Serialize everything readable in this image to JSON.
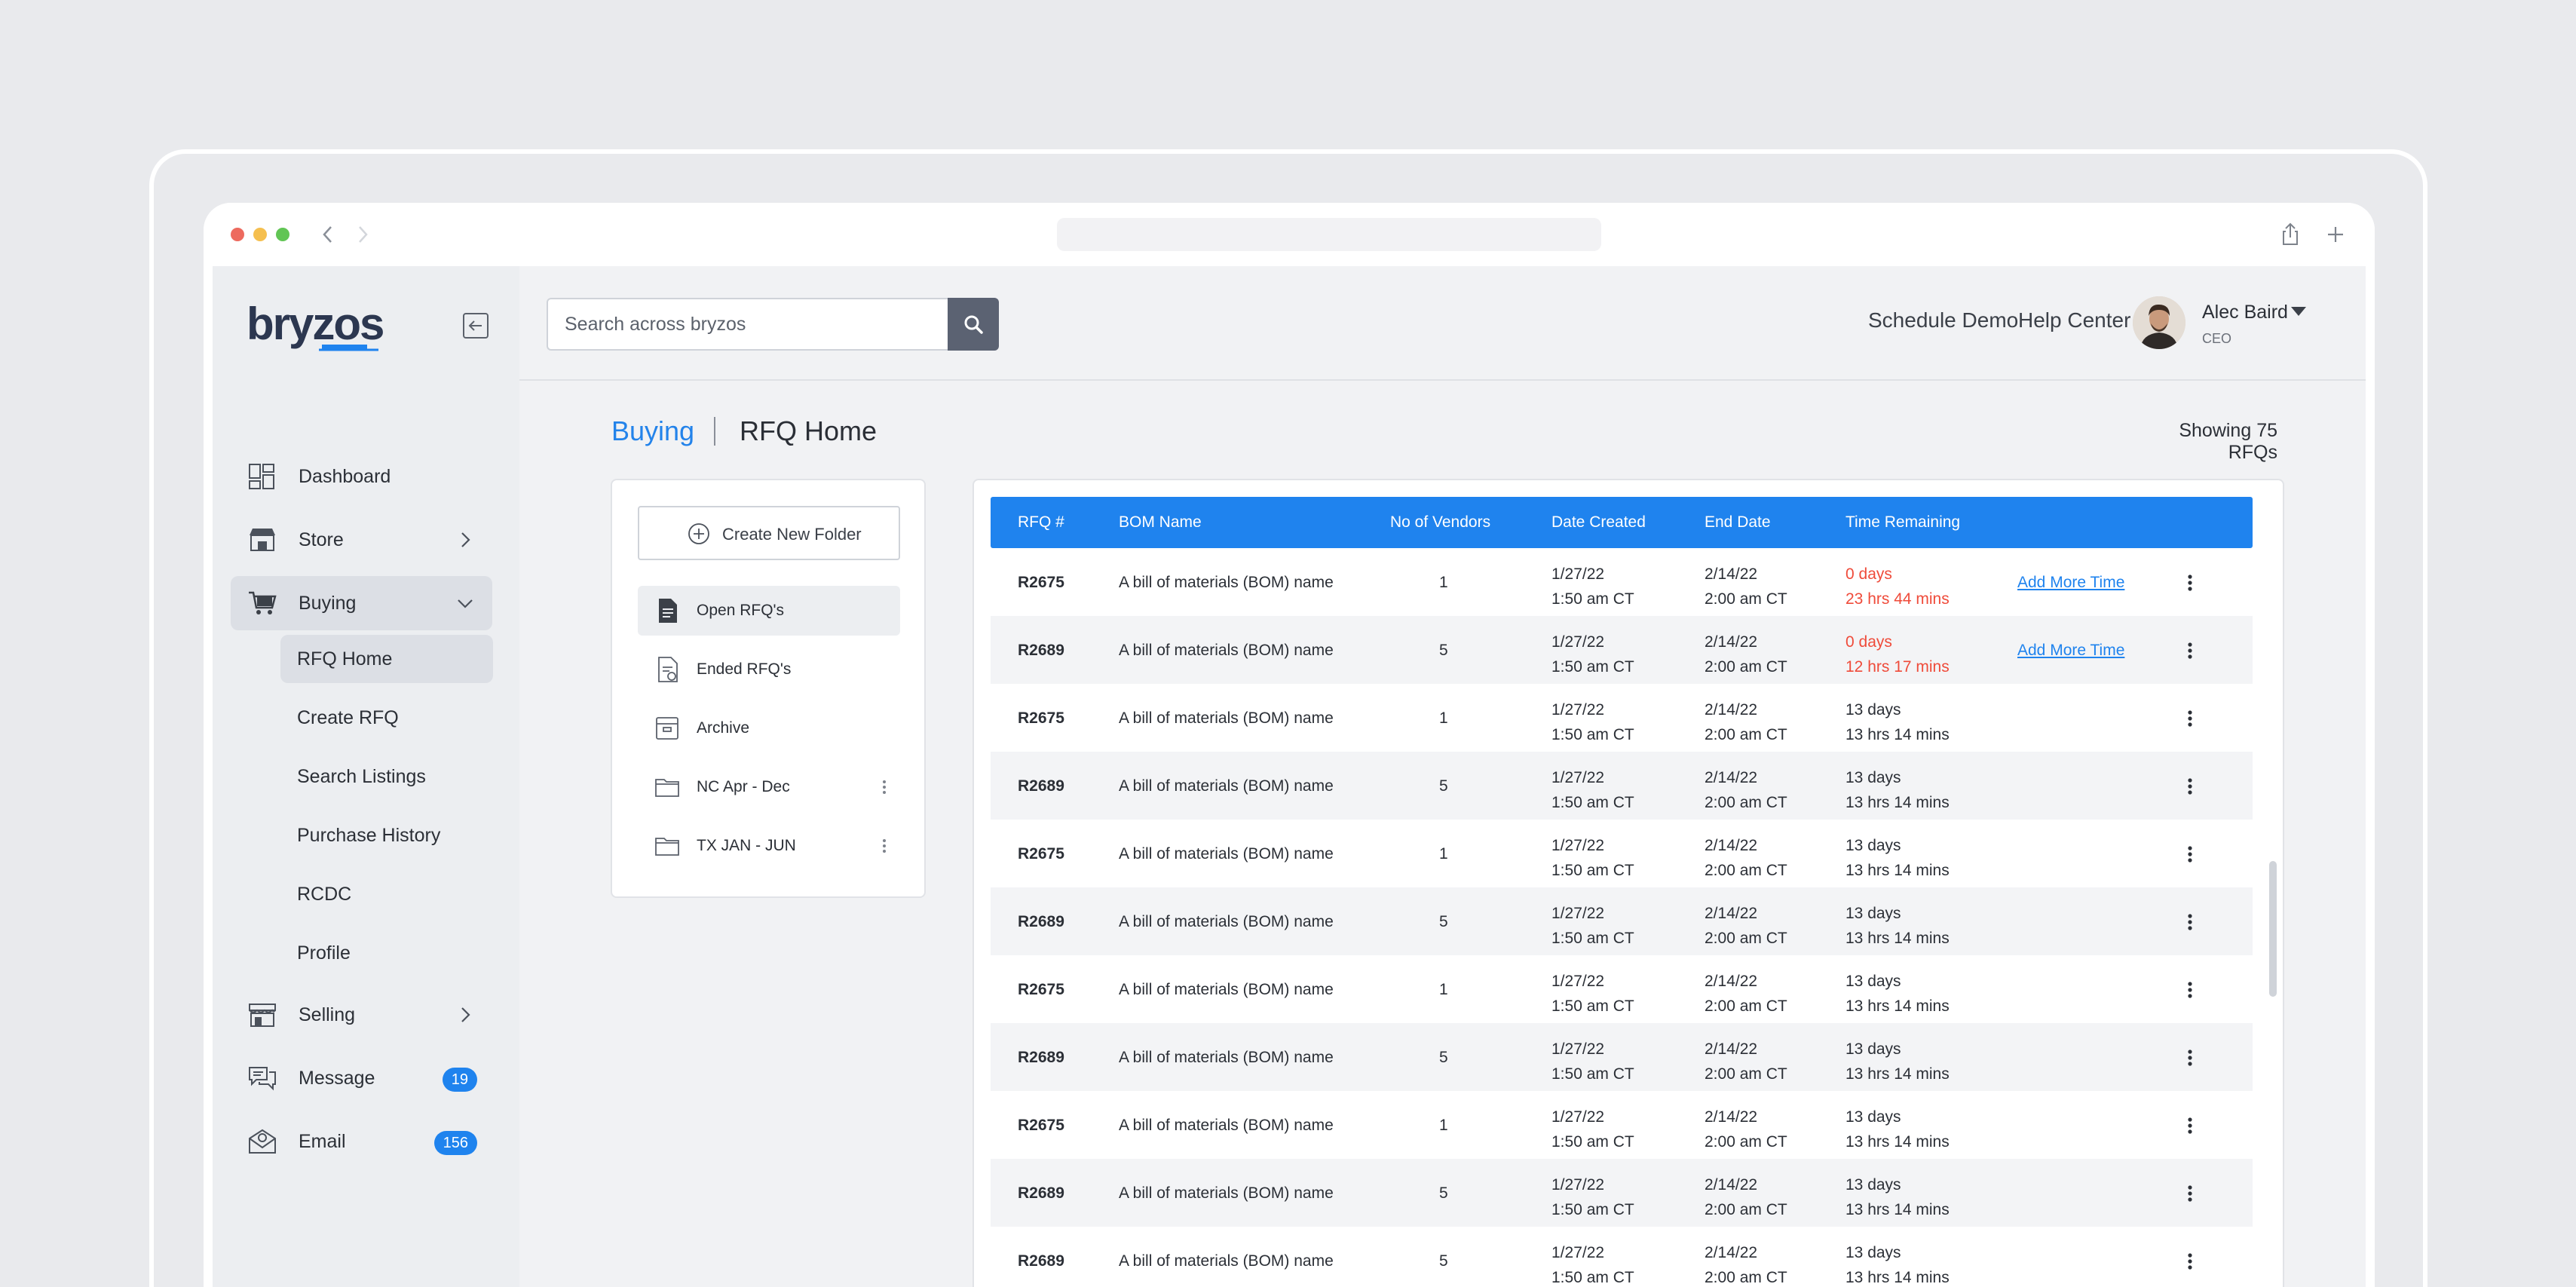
{
  "app": {
    "brand": "bryzos",
    "colors": {
      "accent": "#1f83ee",
      "danger": "#ef4b3a",
      "sidebar": "#eceef1"
    }
  },
  "topbar": {
    "search_placeholder": "Search across bryzos",
    "links": [
      "Schedule Demo",
      "Help Center"
    ],
    "user": {
      "name": "Alec Baird",
      "role": "CEO"
    }
  },
  "sidebar": {
    "items": [
      {
        "label": "Dashboard",
        "icon": "dashboard-icon"
      },
      {
        "label": "Store",
        "icon": "store-icon"
      },
      {
        "label": "Buying",
        "icon": "cart-icon"
      },
      {
        "label": "Selling",
        "icon": "shop-icon"
      },
      {
        "label": "Message",
        "icon": "chat-icon",
        "badge": "19"
      },
      {
        "label": "Email",
        "icon": "mail-icon",
        "badge": "156"
      }
    ],
    "buying_sub": [
      "RFQ Home",
      "Create RFQ",
      "Search Listings",
      "Purchase History",
      "RCDC",
      "Profile"
    ]
  },
  "page": {
    "breadcrumb_section": "Buying",
    "breadcrumb_title": "RFQ Home",
    "showing": "Showing 75 RFQs"
  },
  "folders": {
    "create_label": "Create New Folder",
    "items": [
      "Open RFQ's",
      "Ended RFQ's",
      "Archive",
      "NC Apr - Dec",
      "TX JAN - JUN"
    ]
  },
  "table": {
    "headers": [
      "RFQ #",
      "BOM Name",
      "No of Vendors",
      "Date Created",
      "End Date",
      "Time Remaining"
    ],
    "action_label": "Add More Time",
    "rows": [
      {
        "id": "R2675",
        "bom": "A bill of materials (BOM) name",
        "vendors": "1",
        "created_date": "1/27/22",
        "created_time": "1:50 am CT",
        "end_date": "2/14/22",
        "end_time": "2:00 am CT",
        "remaining_days": "0 days",
        "remaining_time": "23 hrs 44 mins",
        "urgent": true
      },
      {
        "id": "R2689",
        "bom": "A bill of materials (BOM) name",
        "vendors": "5",
        "created_date": "1/27/22",
        "created_time": "1:50 am CT",
        "end_date": "2/14/22",
        "end_time": "2:00 am CT",
        "remaining_days": "0 days",
        "remaining_time": "12 hrs 17 mins",
        "urgent": true
      },
      {
        "id": "R2675",
        "bom": "A bill of materials (BOM) name",
        "vendors": "1",
        "created_date": "1/27/22",
        "created_time": "1:50 am CT",
        "end_date": "2/14/22",
        "end_time": "2:00 am CT",
        "remaining_days": "13 days",
        "remaining_time": "13 hrs 14 mins",
        "urgent": false
      },
      {
        "id": "R2689",
        "bom": "A bill of materials (BOM) name",
        "vendors": "5",
        "created_date": "1/27/22",
        "created_time": "1:50 am CT",
        "end_date": "2/14/22",
        "end_time": "2:00 am CT",
        "remaining_days": "13 days",
        "remaining_time": "13 hrs 14 mins",
        "urgent": false
      },
      {
        "id": "R2675",
        "bom": "A bill of materials (BOM) name",
        "vendors": "1",
        "created_date": "1/27/22",
        "created_time": "1:50 am CT",
        "end_date": "2/14/22",
        "end_time": "2:00 am CT",
        "remaining_days": "13 days",
        "remaining_time": "13 hrs 14 mins",
        "urgent": false
      },
      {
        "id": "R2689",
        "bom": "A bill of materials (BOM) name",
        "vendors": "5",
        "created_date": "1/27/22",
        "created_time": "1:50 am CT",
        "end_date": "2/14/22",
        "end_time": "2:00 am CT",
        "remaining_days": "13 days",
        "remaining_time": "13 hrs 14 mins",
        "urgent": false
      },
      {
        "id": "R2675",
        "bom": "A bill of materials (BOM) name",
        "vendors": "1",
        "created_date": "1/27/22",
        "created_time": "1:50 am CT",
        "end_date": "2/14/22",
        "end_time": "2:00 am CT",
        "remaining_days": "13 days",
        "remaining_time": "13 hrs 14 mins",
        "urgent": false
      },
      {
        "id": "R2689",
        "bom": "A bill of materials (BOM) name",
        "vendors": "5",
        "created_date": "1/27/22",
        "created_time": "1:50 am CT",
        "end_date": "2/14/22",
        "end_time": "2:00 am CT",
        "remaining_days": "13 days",
        "remaining_time": "13 hrs 14 mins",
        "urgent": false
      },
      {
        "id": "R2675",
        "bom": "A bill of materials (BOM) name",
        "vendors": "1",
        "created_date": "1/27/22",
        "created_time": "1:50 am CT",
        "end_date": "2/14/22",
        "end_time": "2:00 am CT",
        "remaining_days": "13 days",
        "remaining_time": "13 hrs 14 mins",
        "urgent": false
      },
      {
        "id": "R2689",
        "bom": "A bill of materials (BOM) name",
        "vendors": "5",
        "created_date": "1/27/22",
        "created_time": "1:50 am CT",
        "end_date": "2/14/22",
        "end_time": "2:00 am CT",
        "remaining_days": "13 days",
        "remaining_time": "13 hrs 14 mins",
        "urgent": false
      },
      {
        "id": "R2689",
        "bom": "A bill of materials (BOM) name",
        "vendors": "5",
        "created_date": "1/27/22",
        "created_time": "1:50 am CT",
        "end_date": "2/14/22",
        "end_time": "2:00 am CT",
        "remaining_days": "13 days",
        "remaining_time": "13 hrs 14 mins",
        "urgent": false
      }
    ]
  }
}
